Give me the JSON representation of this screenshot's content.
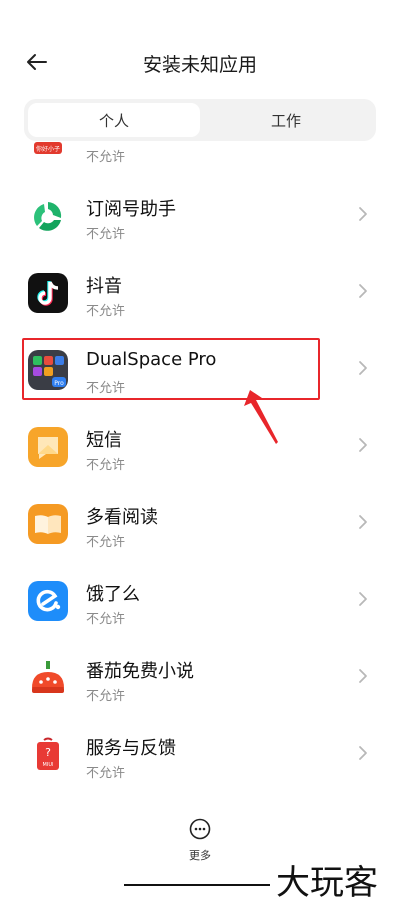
{
  "header": {
    "title": "安装未知应用",
    "back_icon": "arrow-left-icon"
  },
  "tabs": [
    {
      "label": "个人",
      "active": true
    },
    {
      "label": "工作",
      "active": false
    }
  ],
  "partial_item": {
    "status": "不允许",
    "logo_text": "你好小子"
  },
  "apps": [
    {
      "name": "订阅号助手",
      "status": "不允许",
      "icon": "subscription-assistant-icon"
    },
    {
      "name": "抖音",
      "status": "不允许",
      "icon": "douyin-icon"
    },
    {
      "name": "DualSpace Pro",
      "status": "不允许",
      "icon": "dualspace-icon",
      "highlighted": true,
      "badge": "Pro"
    },
    {
      "name": "短信",
      "status": "不允许",
      "icon": "messages-icon"
    },
    {
      "name": "多看阅读",
      "status": "不允许",
      "icon": "duokan-reader-icon"
    },
    {
      "name": "饿了么",
      "status": "不允许",
      "icon": "eleme-icon"
    },
    {
      "name": "番茄免费小说",
      "status": "不允许",
      "icon": "fanqie-novel-icon"
    },
    {
      "name": "服务与反馈",
      "status": "不允许",
      "icon": "service-feedback-icon",
      "badge": "MIUI"
    }
  ],
  "footer": {
    "more_label": "更多",
    "more_icon": "more-dots-icon"
  },
  "watermark": {
    "text": "大玩客"
  },
  "colors": {
    "highlight": "#e8262b",
    "status_text": "#8a8a8a",
    "tab_bg": "#f2f2f2"
  }
}
